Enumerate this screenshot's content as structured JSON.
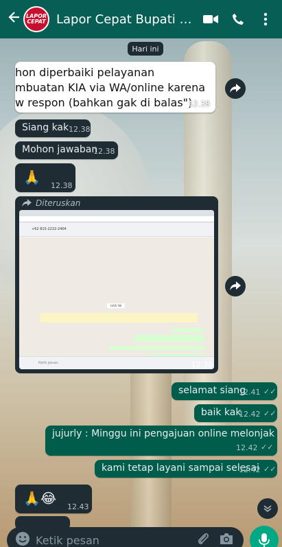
{
  "header": {
    "title": "Lapor Cepat Bupati Kebu...",
    "avatar_text_top": "LAPOR",
    "avatar_text_bottom": "CEPAT"
  },
  "date_chip": "Hari ini",
  "quoted_message": {
    "lines": [
      "hon diperbaiki pelayanan",
      "mbuatan KIA via WA/online karena",
      "w respon (bahkan gak di balas\")"
    ],
    "time": "12.38"
  },
  "messages_in": [
    {
      "text": "Siang kak",
      "time": "12.38"
    },
    {
      "text": "Mohon jawaban",
      "time": "12.38"
    },
    {
      "text": "🙏",
      "time": "12.38"
    }
  ],
  "forwarded": {
    "label": "Diteruskan",
    "time": "12.38",
    "mini_screen": {
      "contact": "+62 815-2232-2404",
      "date": "HARI INI",
      "placeholder": "Ketik pesan"
    }
  },
  "messages_out": [
    {
      "text": "selamat siang",
      "time": "12.41"
    },
    {
      "text": "baik kak",
      "time": "12.42"
    },
    {
      "text": "jujurly : Minggu ini pengajuan online melonjak",
      "time": "12.42"
    },
    {
      "text": "kami tetap layani sampai selesai",
      "time": "12.42"
    }
  ],
  "last_in": {
    "text": "🙏😂",
    "time": "12.43"
  },
  "input": {
    "placeholder": "Ketik pesan"
  },
  "colors": {
    "header": "#075e54",
    "incoming": "#1f2c34",
    "outgoing": "#005c4b",
    "accent": "#00a884"
  }
}
